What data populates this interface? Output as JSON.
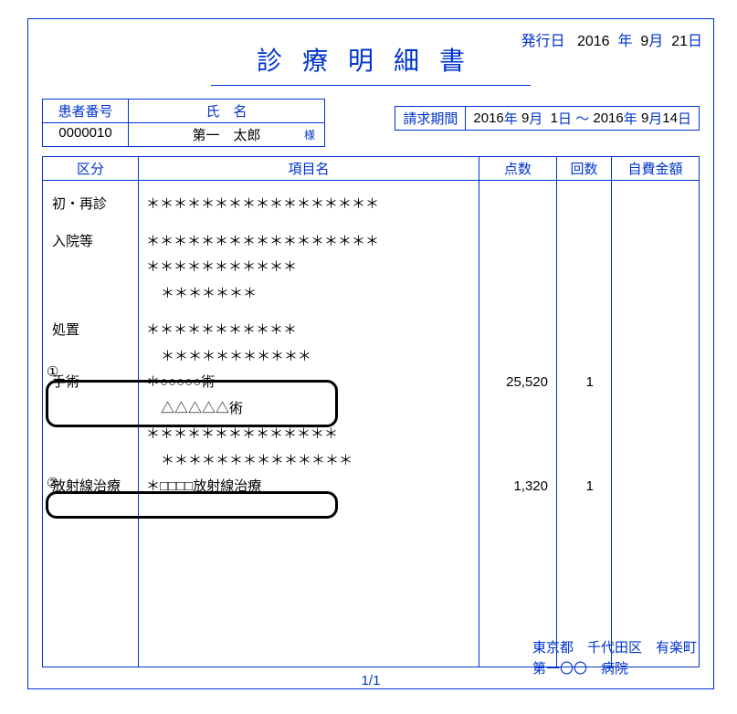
{
  "issue": {
    "label": "発行日",
    "year": "2016",
    "year_unit": "年",
    "month": "9",
    "month_unit": "月",
    "day": "21",
    "day_unit": "日"
  },
  "title": "診療明細書",
  "patient": {
    "no_head": "患者番号",
    "no_val": "0000010",
    "name_head": "氏　名",
    "name_val": "第一　太郎",
    "honorific": "様"
  },
  "billing": {
    "head": "請求期間",
    "from_year": "2016",
    "from_month": "9",
    "from_day": "1",
    "sep": "～",
    "to_year": "2016",
    "to_month": "9",
    "to_day": "14",
    "y_unit": "年",
    "m_unit": "月",
    "d_unit": "日"
  },
  "headers": {
    "kubun": "区分",
    "koumoku": "項目名",
    "tensuu": "点数",
    "kaisuu": "回数",
    "jihi": "自費金額"
  },
  "rows": {
    "r1_kubun": "初・再診",
    "r1_item": "＊＊＊＊＊＊＊＊＊＊＊＊＊＊＊＊＊",
    "r2_kubun": "入院等",
    "r2_item1": "＊＊＊＊＊＊＊＊＊＊＊＊＊＊＊＊＊",
    "r2_item2": "＊＊＊＊＊＊＊＊＊＊＊",
    "r2_item3": "＊＊＊＊＊＊＊",
    "r3_kubun": "処置",
    "r3_item1": "＊＊＊＊＊＊＊＊＊＊＊",
    "r3_item2": "＊＊＊＊＊＊＊＊＊＊＊",
    "ann1": "①",
    "r4_kubun": "手術",
    "r4_item1": "＊○○○○○術",
    "r4_item2": "△△△△△術",
    "r4_tensuu": "25,520",
    "r4_kaisuu": "1",
    "r4_item3": "＊＊＊＊＊＊＊＊＊＊＊＊＊＊",
    "r4_item4": "＊＊＊＊＊＊＊＊＊＊＊＊＊＊",
    "ann2": "②",
    "r5_kubun": "放射線治療",
    "r5_item": "＊□□□□放射線治療",
    "r5_tensuu": "1,320",
    "r5_kaisuu": "1"
  },
  "page_num": "1/1",
  "footer": {
    "line1": "東京都　千代田区　有楽町",
    "line2": "第一〇〇　病院"
  }
}
